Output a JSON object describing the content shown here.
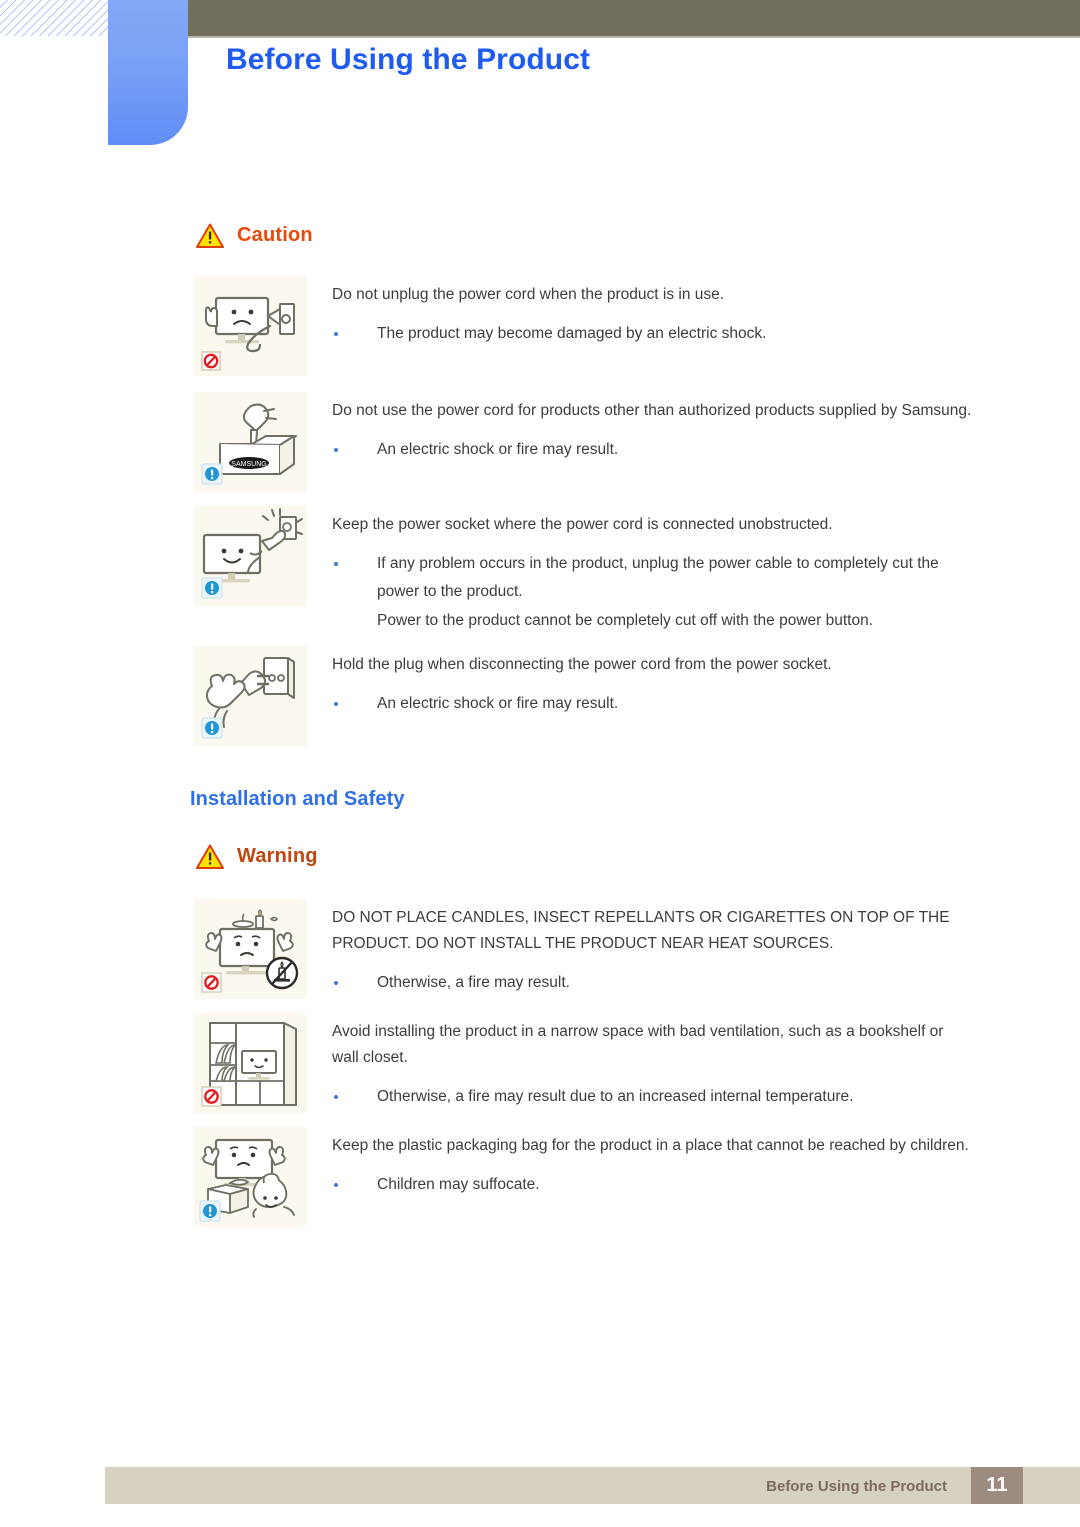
{
  "header": {
    "title": "Before Using the Product"
  },
  "sections": [
    {
      "id": "caution",
      "notice": {
        "label": "Caution",
        "icon": "warning-triangle-icon",
        "color": "#e8490b"
      },
      "entries": [
        {
          "thumb": "monitor-unplug-prohibited-illustration",
          "badge": "prohibited-icon",
          "lead": "Do not unplug the power cord when the product is in use.",
          "bullets": [
            "The product may become damaged by an electric shock."
          ]
        },
        {
          "thumb": "plug-samsung-box-illustration",
          "badge": "info-icon",
          "lead": "Do not use the power cord for products other than authorized products supplied by Samsung.",
          "bullets": [
            "An electric shock or fire may result."
          ]
        },
        {
          "thumb": "monitor-socket-unobstructed-illustration",
          "badge": "info-icon",
          "lead": "Keep the power socket where the power cord is connected unobstructed.",
          "bullets": [
            "If any problem occurs in the product, unplug the power cable to completely cut the power to the product.",
            "Power to the product cannot be completely cut off with the power button."
          ]
        },
        {
          "thumb": "hand-holding-plug-illustration",
          "badge": "info-icon",
          "lead": "Hold the plug when disconnecting the power cord from the power socket.",
          "bullets": [
            "An electric shock or fire may result."
          ]
        }
      ]
    },
    {
      "id": "installation-and-safety",
      "heading": "Installation and Safety",
      "notice": {
        "label": "Warning",
        "icon": "warning-triangle-icon",
        "color": "#bf4610"
      },
      "entries": [
        {
          "thumb": "monitor-candles-prohibited-illustration",
          "badge": "prohibited-icon",
          "lead": "DO NOT PLACE CANDLES, INSECT REPELLANTS OR CIGARETTES ON TOP OF THE PRODUCT. DO NOT INSTALL THE PRODUCT NEAR HEAT SOURCES.",
          "bullets": [
            "Otherwise, a fire may result."
          ]
        },
        {
          "thumb": "monitor-in-bookshelf-prohibited-illustration",
          "badge": "prohibited-icon",
          "lead": "Avoid installing the product in a narrow space with bad ventilation, such as a bookshelf or wall closet.",
          "bullets": [
            "Otherwise, a fire may result due to an increased internal temperature."
          ]
        },
        {
          "thumb": "child-plastic-bag-illustration",
          "badge": "info-icon",
          "lead": "Keep the plastic packaging bag for the product in a place that cannot be reached by children.",
          "bullets": [
            "Children may suffocate."
          ]
        }
      ]
    }
  ],
  "footer": {
    "label": "Before Using the Product",
    "page": "11"
  }
}
